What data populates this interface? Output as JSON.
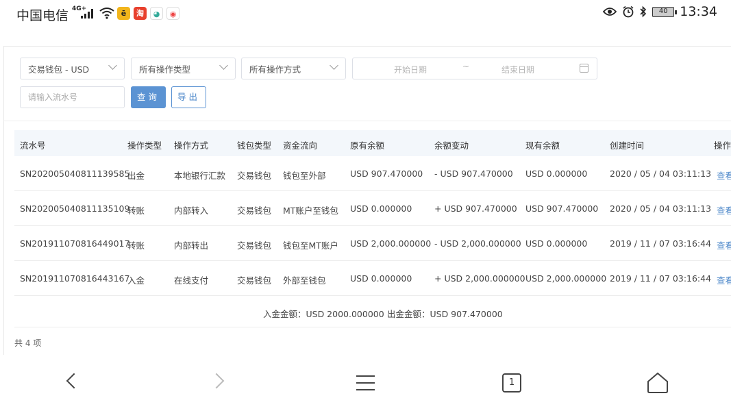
{
  "status_bar": {
    "carrier": "中国电信",
    "network": "4G+",
    "battery": "40",
    "time": "13:34"
  },
  "filters": {
    "wallet": "交易钱包 - USD",
    "op_type": "所有操作类型",
    "op_method": "所有操作方式",
    "start_date_placeholder": "开始日期",
    "range_separator": "~",
    "end_date_placeholder": "结束日期",
    "serial_placeholder": "请输入流水号",
    "query_label": "查询",
    "export_label": "导出"
  },
  "table": {
    "headers": [
      "流水号",
      "操作类型",
      "操作方式",
      "钱包类型",
      "资金流向",
      "原有余额",
      "余额变动",
      "现有余额",
      "创建时间",
      "操作"
    ],
    "rows": [
      [
        "SN202005040811139585",
        "出金",
        "本地银行汇款",
        "交易钱包",
        "钱包至外部",
        "USD 907.470000",
        "- USD 907.470000",
        "USD 0.000000",
        "2020 / 05 / 04 03:11:13",
        "查看"
      ],
      [
        "SN202005040811135109",
        "转账",
        "内部转入",
        "交易钱包",
        "MT账户至钱包",
        "USD 0.000000",
        "+ USD 907.470000",
        "USD 907.470000",
        "2020 / 05 / 04 03:11:13",
        "查看"
      ],
      [
        "SN201911070816449017",
        "转账",
        "内部转出",
        "交易钱包",
        "钱包至MT账户",
        "USD 2,000.000000",
        "- USD 2,000.000000",
        "USD 0.000000",
        "2019 / 11 / 07 03:16:44",
        "查看"
      ],
      [
        "SN201911070816443167",
        "入金",
        "在线支付",
        "交易钱包",
        "外部至钱包",
        "USD 0.000000",
        "+ USD 2,000.000000",
        "USD 2,000.000000",
        "2019 / 11 / 07 03:16:44",
        "查看"
      ]
    ],
    "summary_in": "入金金额：USD 2000.000000",
    "summary_out": "出金金额：USD 907.470000",
    "total": "共 4 项"
  },
  "nav": {
    "tab_count": "1"
  },
  "colors": {
    "accent": "#5b93d3",
    "link": "#4a86c9",
    "header_bg": "#f3f7fb"
  }
}
